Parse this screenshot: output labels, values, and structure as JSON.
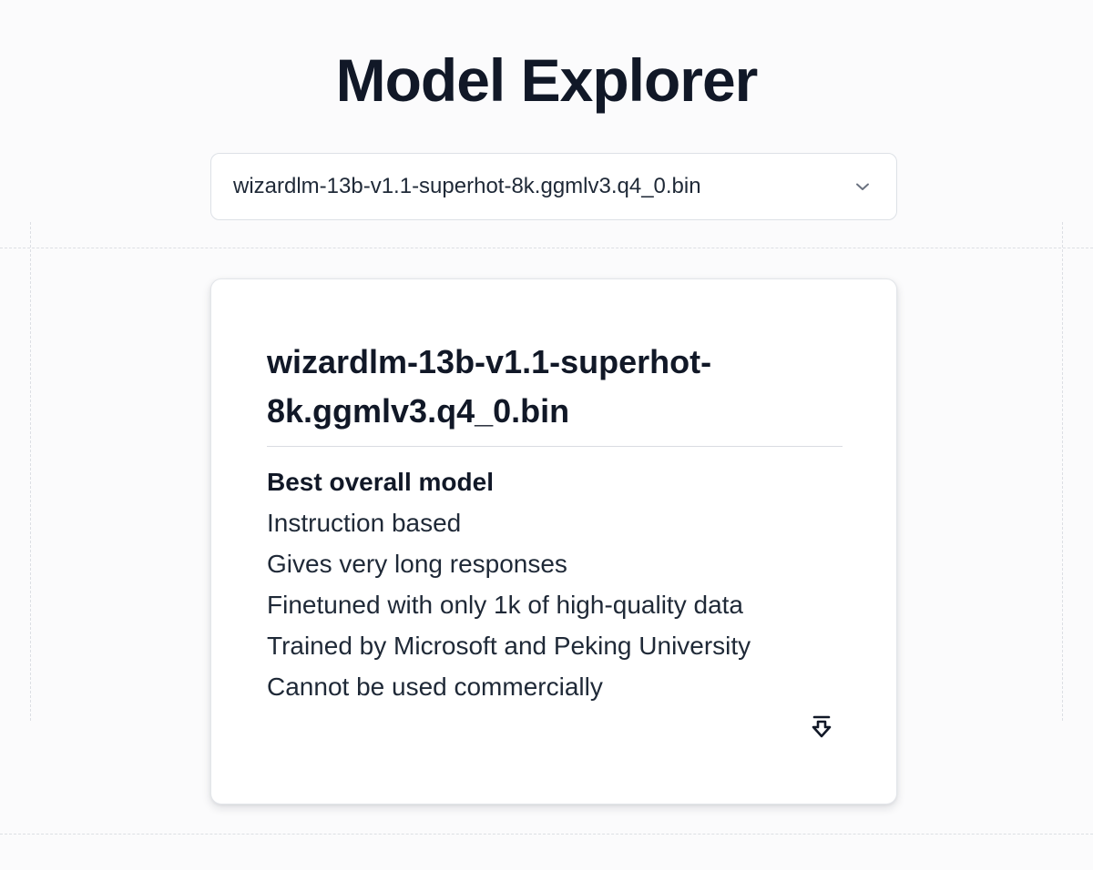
{
  "header": {
    "title": "Model Explorer"
  },
  "model_select": {
    "selected_value": "wizardlm-13b-v1.1-superhot-8k.ggmlv3.q4_0.bin",
    "icon": "chevron-down-icon"
  },
  "model_card": {
    "title": "wizardlm-13b-v1.1-superhot-8k.ggmlv3.q4_0.bin",
    "features": [
      "Best overall model",
      "Instruction based",
      "Gives very long responses",
      "Finetuned with only 1k of high-quality data",
      "Trained by Microsoft and Peking University",
      "Cannot be used commercially"
    ],
    "download_icon": "download-icon"
  },
  "colors": {
    "text_primary": "#111827",
    "border": "#dde1e6",
    "background": "#fbfbfc"
  }
}
